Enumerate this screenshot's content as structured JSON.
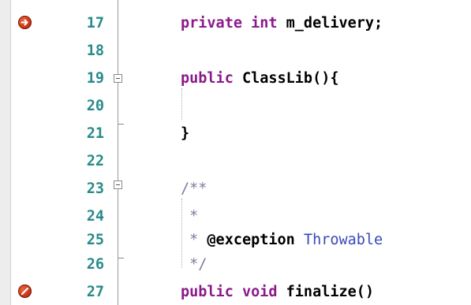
{
  "editor": {
    "lines": [
      {
        "number": "17",
        "tokens": [
          {
            "t": "kw",
            "v": "private int "
          },
          {
            "t": "plain",
            "v": "m_delivery;"
          }
        ]
      },
      {
        "number": "18",
        "tokens": []
      },
      {
        "number": "19",
        "tokens": [
          {
            "t": "kw",
            "v": "public "
          },
          {
            "t": "plain",
            "v": "ClassLib(){"
          }
        ]
      },
      {
        "number": "20",
        "tokens": []
      },
      {
        "number": "21",
        "tokens": [
          {
            "t": "plain",
            "v": "}"
          }
        ]
      },
      {
        "number": "22",
        "tokens": []
      },
      {
        "number": "23",
        "tokens": [
          {
            "t": "comment",
            "v": "/**"
          }
        ]
      },
      {
        "number": "24",
        "tokens": [
          {
            "t": "comment",
            "v": " *"
          }
        ]
      },
      {
        "number": "25",
        "tokens": [
          {
            "t": "comment",
            "v": " * "
          },
          {
            "t": "doc-tag",
            "v": "@exception "
          },
          {
            "t": "type-ref",
            "v": "Throwable"
          }
        ]
      },
      {
        "number": "26",
        "tokens": [
          {
            "t": "comment",
            "v": " */"
          }
        ]
      },
      {
        "number": "27",
        "tokens": [
          {
            "t": "kw",
            "v": "public void "
          },
          {
            "t": "plain",
            "v": "finalize()"
          }
        ]
      }
    ],
    "breakpoints": [
      {
        "line": "17",
        "icon": "current-line-breakpoint-icon"
      },
      {
        "line": "27",
        "icon": "disabled-breakpoint-icon"
      }
    ],
    "folds": [
      {
        "start": "19",
        "end": "21"
      },
      {
        "start": "23",
        "end": "26"
      }
    ]
  }
}
